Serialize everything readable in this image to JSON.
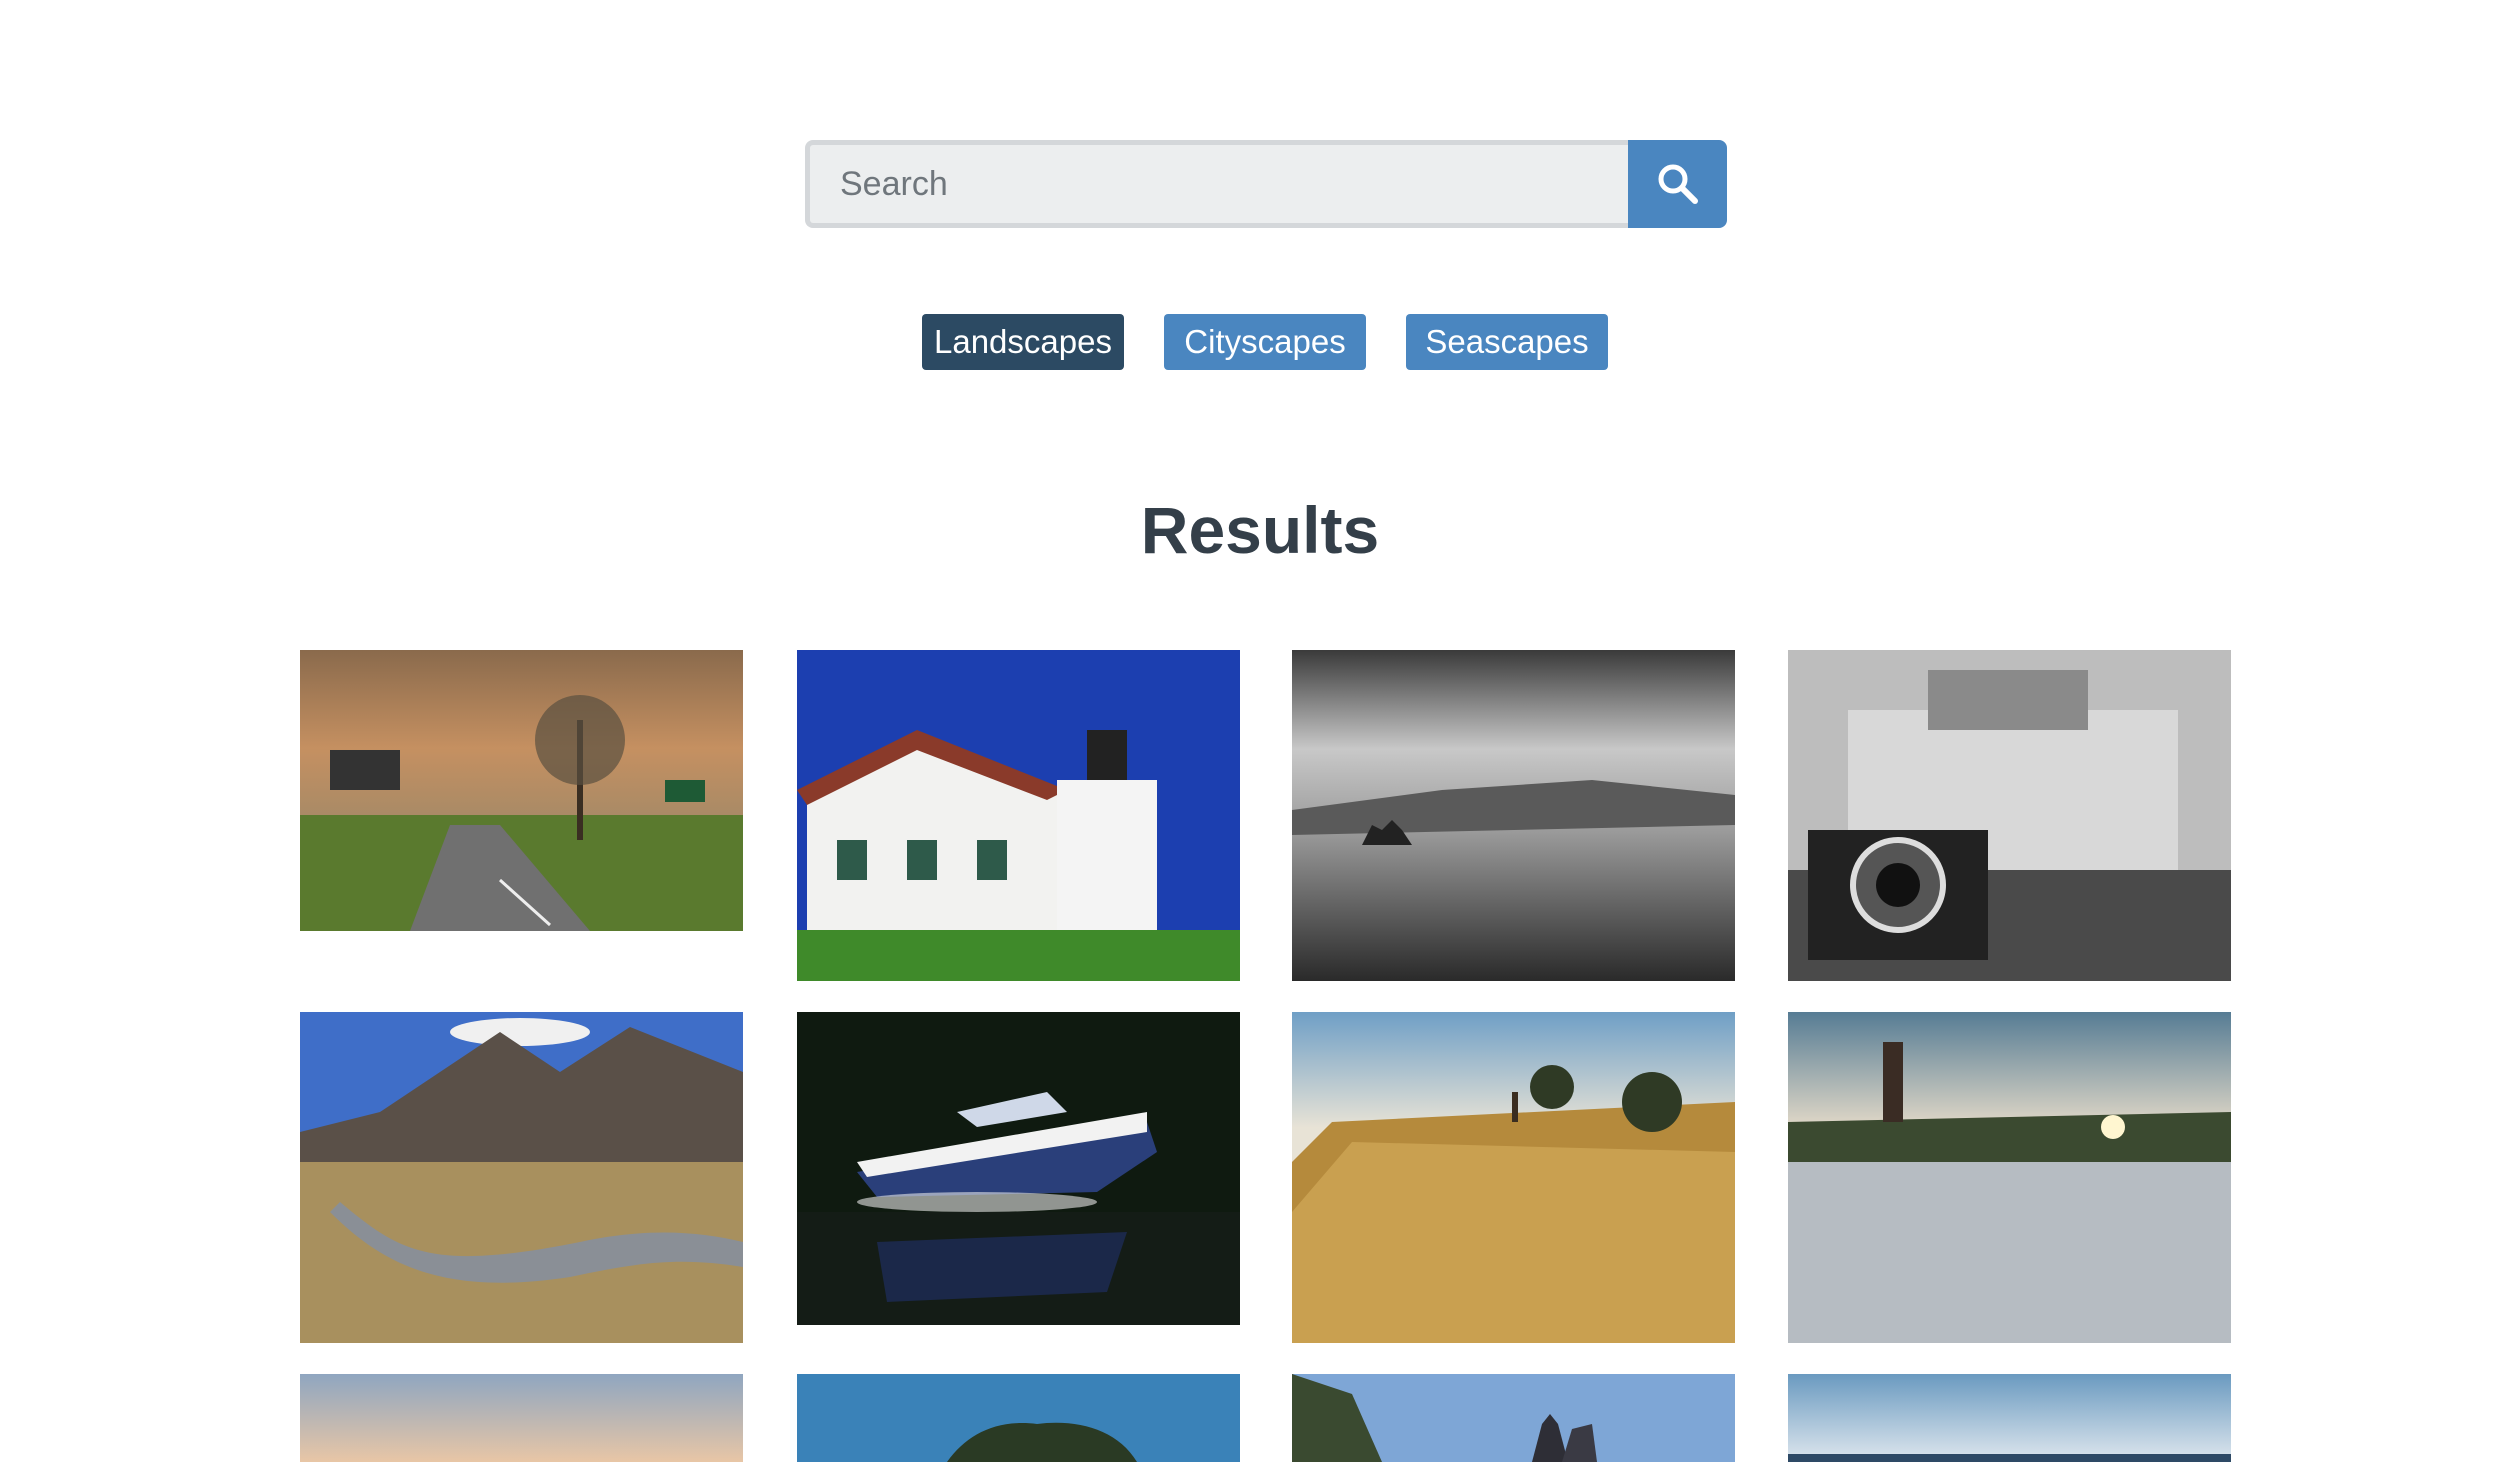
{
  "search": {
    "placeholder": "Search",
    "value": "",
    "button_icon": "search-icon"
  },
  "colors": {
    "accent": "#4a86c0",
    "active_tag": "#2c4a63",
    "heading": "#343f49",
    "input_bg": "#eceeef"
  },
  "tags": [
    {
      "label": "Landscapes",
      "active": true
    },
    {
      "label": "Cityscapes",
      "active": false
    },
    {
      "label": "Seascapes",
      "active": false
    }
  ],
  "results": {
    "title": "Results",
    "photos": [
      {
        "subject": "country road with tree at sunset"
      },
      {
        "subject": "white lighthouse house under blue sky"
      },
      {
        "subject": "black and white misty valley"
      },
      {
        "subject": "black and white camera in front of building"
      },
      {
        "subject": "mountain valley with river"
      },
      {
        "subject": "speedboat on dark water"
      },
      {
        "subject": "dune grass with lighthouse"
      },
      {
        "subject": "lighthouse on beach at sunset"
      },
      {
        "subject": "dusk sky"
      },
      {
        "subject": "trees on hill under blue sky"
      },
      {
        "subject": "church tower with trees"
      },
      {
        "subject": "calm sea horizon"
      }
    ]
  }
}
